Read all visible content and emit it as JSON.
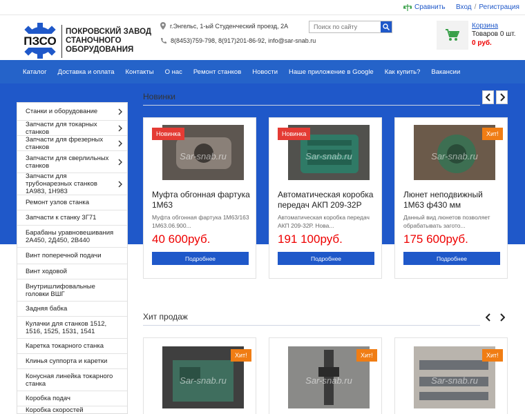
{
  "topbar": {
    "compare": "Сравнить",
    "login": "Вход",
    "separator": "/",
    "register": "Регистрация"
  },
  "header": {
    "logo_mark": "ПЗСО",
    "company_name": "Покровский завод станочного оборудования",
    "address": "г.Энгельс, 1-ый Студенческий проезд, 2А",
    "contacts": "8(8453)759-798, 8(917)201-86-92, info@sar-snab.ru",
    "search_placeholder": "Поиск по сайту",
    "cart_title": "Корзина",
    "cart_count": "Товаров 0 шт.",
    "cart_sum": "0 руб."
  },
  "nav": [
    "Каталог",
    "Доставка и оплата",
    "Контакты",
    "О нас",
    "Ремонт станков",
    "Новости",
    "Наше приложение в Google",
    "Как купить?",
    "Вакансии"
  ],
  "sidebar": [
    {
      "label": "Станки и оборудование",
      "arrow": true
    },
    {
      "label": "Запчасти для токарных станков",
      "arrow": true
    },
    {
      "label": "Запчасти для фрезерных станков",
      "arrow": true
    },
    {
      "label": "Запчасти для сверлильных станков",
      "arrow": true
    },
    {
      "label": "Запчасти для трубонарезных станков 1А983, 1Н983",
      "arrow": true
    },
    {
      "label": "Ремонт узлов станка",
      "arrow": false
    },
    {
      "label": "Запчасти к станку 3Г71",
      "arrow": false
    },
    {
      "label": "Барабаны уравновешивания 2А450, 2Д450, 2В440",
      "arrow": false
    },
    {
      "label": "Винт поперечной подачи",
      "arrow": false
    },
    {
      "label": "Винт ходовой",
      "arrow": false
    },
    {
      "label": "Внутришлифовальные головки ВШГ",
      "arrow": false
    },
    {
      "label": "Задняя бабка",
      "arrow": false
    },
    {
      "label": "Кулачки для станков 1512, 1516, 1525, 1531, 1541",
      "arrow": false
    },
    {
      "label": "Каретка токарного станка",
      "arrow": false
    },
    {
      "label": "Клинья суппорта и каретки",
      "arrow": false
    },
    {
      "label": "Конусная линейка токарного станка",
      "arrow": false
    },
    {
      "label": "Коробка подач",
      "arrow": false
    },
    {
      "label": "Коробка скоростей (шпиндельная",
      "arrow": false
    }
  ],
  "new_section": {
    "title": "Новинки",
    "products": [
      {
        "badge": "Новинка",
        "badge_type": "new",
        "name": "Муфта обгонная фартука 1М63",
        "desc": "Муфта обгонная фартука 1М63/163 1М63.06.900...",
        "price": "40 600руб.",
        "button": "Подробнее",
        "watermark": "Sar-snab.ru",
        "img_color": "#5d5650"
      },
      {
        "badge": "Новинка",
        "badge_type": "new",
        "name": "Автоматическая коробка передач АКП 209-32Р",
        "desc": "Автоматическая коробка передач АКП 209-32Р. Нова...",
        "price": "191 100руб.",
        "button": "Подробнее",
        "watermark": "Sar-snab.ru",
        "img_color": "#2f7a66"
      },
      {
        "badge": "Хит!",
        "badge_type": "hit",
        "name": "Люнет неподвижный 1М63 ф430 мм",
        "desc": "Данный вид люнетов позволяет обрабатывать загото...",
        "price": "175 600руб.",
        "button": "Подробнее",
        "watermark": "Sar-snab.ru",
        "img_color": "#3d6f52"
      }
    ]
  },
  "hit_section": {
    "title": "Хит продаж",
    "products": [
      {
        "badge": "Хит!",
        "badge_type": "hit",
        "watermark": "Sar-snab.ru",
        "img_color": "#3f6e5e"
      },
      {
        "badge": "Хит!",
        "badge_type": "hit",
        "watermark": "Sar-snab.ru",
        "img_color": "#3a3a3a"
      },
      {
        "badge": "Хит!",
        "badge_type": "hit",
        "watermark": "Sar-snab.ru",
        "img_color": "#6b6f74"
      }
    ]
  },
  "colors": {
    "brand_blue": "#1f58c9",
    "nav_blue": "#2563c9",
    "price_red": "#e00000",
    "badge_new": "#e43b34",
    "badge_hit": "#f07d14"
  }
}
